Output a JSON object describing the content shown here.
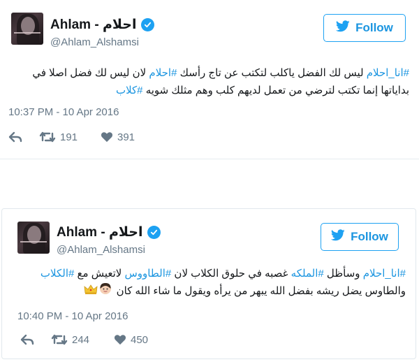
{
  "tweets": [
    {
      "display_name": "Ahlam - احلام",
      "handle": "@Ahlam_Alshamsi",
      "follow_label": "Follow",
      "text_line1": {
        "h1": "#انا_احلام",
        "t1": " ليس لك الفضل ياكلب لتكتب عن تاج رأسك ",
        "h2": "#احلام",
        "t2": " لان ليس لك فضل اصلا في"
      },
      "text_line2": {
        "t1": "بداياتها إنما تكتب لترضي من تعمل لديهم كلب وهم مثلك شويه ",
        "h1": "#كلاب"
      },
      "timestamp": "10:37 PM - 10 Apr 2016",
      "retweets": "191",
      "likes": "391"
    },
    {
      "display_name": "Ahlam - احلام",
      "handle": "@Ahlam_Alshamsi",
      "follow_label": "Follow",
      "text_line1": {
        "h1": "#انا_احلام",
        "t1": " وسأظل ",
        "h2": "#الملكه",
        "t2": " غصبه في حلوق الكلاب لان ",
        "h3": "#الطاووس",
        "t3": " لاتعيش مع ",
        "h4": "#الكلاب"
      },
      "text_line2": {
        "t1": "والطاوس يضل ريشه بفضل الله يبهر من يرأه ويقول ما شاء الله كان "
      },
      "timestamp": "10:40 PM - 10 Apr 2016",
      "retweets": "244",
      "likes": "450"
    }
  ],
  "icons": {
    "twitter_bird": "twitter-bird-icon",
    "verified": "verified-badge-icon",
    "reply": "reply-icon",
    "retweet": "retweet-icon",
    "like": "heart-icon"
  },
  "colors": {
    "accent": "#1da1f2",
    "link": "#1b95e0",
    "muted": "#657786",
    "text": "#14171a"
  }
}
